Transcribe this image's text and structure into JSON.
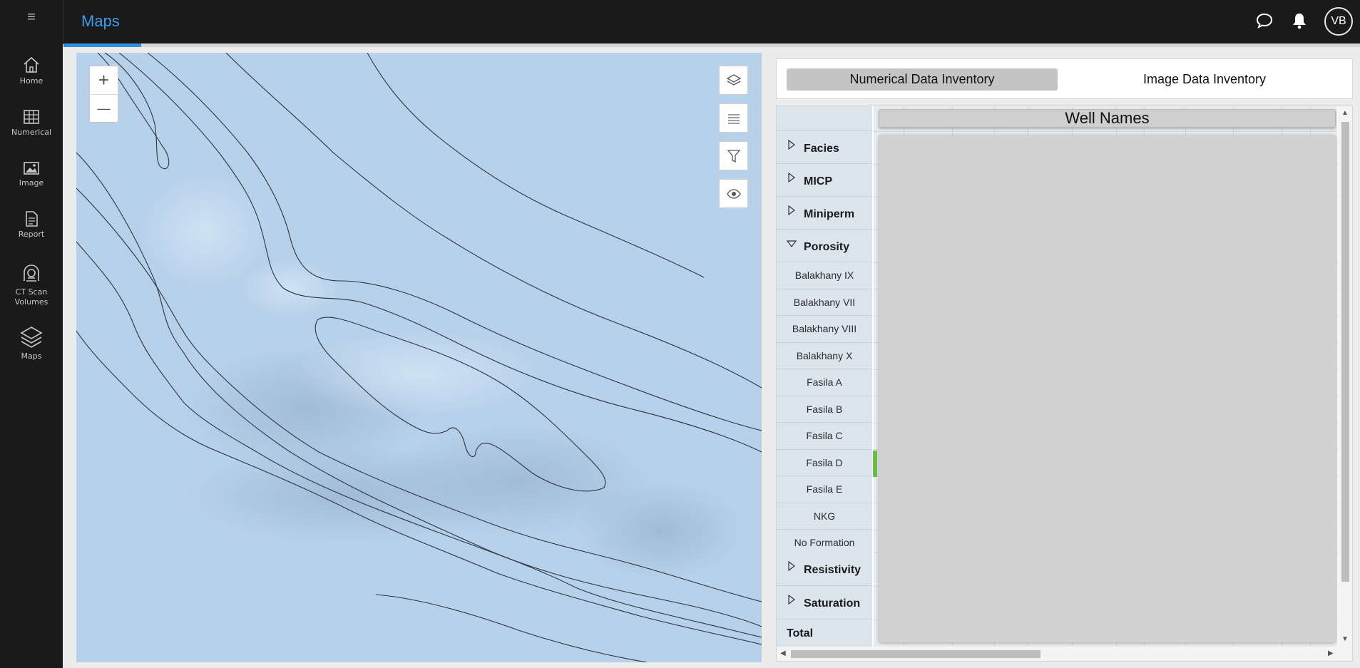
{
  "app": {
    "menu_icon": "hamburger-icon",
    "title": "Maps",
    "user_initials": "VB",
    "page_progress_percent": 6
  },
  "sidebar": {
    "items": [
      {
        "label": "Home",
        "icon": "home-icon"
      },
      {
        "label": "Numerical",
        "icon": "table-icon"
      },
      {
        "label": "Image",
        "icon": "image-icon"
      },
      {
        "label": "Report",
        "icon": "report-icon"
      },
      {
        "label": "CT Scan Volumes",
        "icon": "ct-scan-icon"
      },
      {
        "label": "Maps",
        "icon": "layers-icon"
      }
    ]
  },
  "topbar": {
    "icons": [
      "chat-icon",
      "bell-icon"
    ]
  },
  "map": {
    "zoom_in": "+",
    "zoom_out": "—",
    "tools": [
      "layers-icon",
      "list-icon",
      "filter-icon",
      "eye-icon"
    ],
    "background_color": "#b8d1ea"
  },
  "inventory": {
    "tabs": [
      {
        "label": "Numerical Data Inventory",
        "active": true
      },
      {
        "label": "Image Data Inventory",
        "active": false
      }
    ],
    "header": "Well Names",
    "groups": [
      {
        "label": "Facies",
        "expanded": false
      },
      {
        "label": "MICP",
        "expanded": false
      },
      {
        "label": "Miniperm",
        "expanded": false
      },
      {
        "label": "Porosity",
        "expanded": true
      },
      {
        "label": "Resistivity",
        "expanded": false
      },
      {
        "label": "Saturation",
        "expanded": false
      }
    ],
    "porosity_items": [
      "Balakhany IX",
      "Balakhany VII",
      "Balakhany VIII",
      "Balakhany X",
      "Fasila A",
      "Fasila B",
      "Fasila C",
      "Fasila D",
      "Fasila E",
      "NKG",
      "No Formation"
    ],
    "total_label": "Total",
    "highlight_color": "#6cbd45"
  }
}
